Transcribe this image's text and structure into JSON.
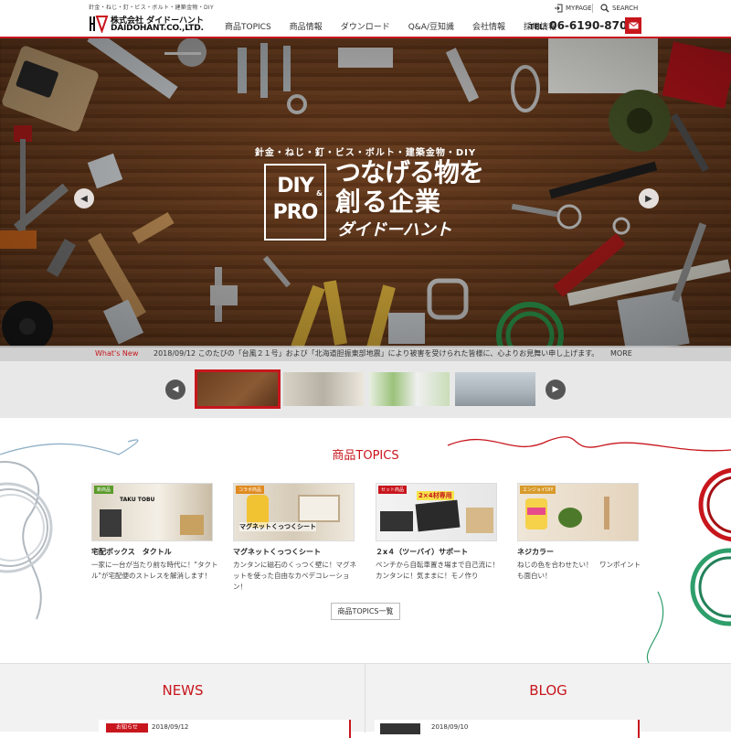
{
  "header": {
    "tagline": "針金・ねじ・釘・ビス・ボルト・建築金物・DIY",
    "logo_jp": "株式会社 ダイドーハント",
    "logo_en": "DAIDOHANT.CO.,LTD.",
    "mypage_label": "MYPAGE",
    "search_label": "SEARCH",
    "tel_label": "TEL:",
    "tel_number": "06-6190-8700",
    "nav": [
      {
        "label": "商品TOPICS"
      },
      {
        "label": "商品情報"
      },
      {
        "label": "ダウンロード"
      },
      {
        "label": "Q&A/豆知識"
      },
      {
        "label": "会社情報"
      },
      {
        "label": "採用情報"
      }
    ],
    "accent": "#c8161d"
  },
  "hero": {
    "subtitle": "針金・ねじ・釘・ビス・ボルト・建築金物・DIY",
    "badge_line1": "DIY",
    "badge_amp": "&",
    "badge_line2": "PRO",
    "catch_line1": "つなげる物を",
    "catch_line2": "創る企業",
    "catch_brand": "ダイドーハント"
  },
  "news_bar": {
    "label": "What's New",
    "text": "2018/09/12 このたびの「台風２１号」および「北海道胆振東部地震」により被害を受けられた皆様に、心よりお見舞い申し上げます。",
    "more": "MORE"
  },
  "topics": {
    "title": "商品TOPICS",
    "list_button": "商品TOPICS一覧",
    "items": [
      {
        "tag": "新商品",
        "image_text": "TAKU TOBU",
        "title": "宅配ボックス　タクトル",
        "desc": "一家に一台が当たり前な時代に！\"タクトル\"が宅配便のストレスを解消します！"
      },
      {
        "tag": "コラボ商品",
        "image_text": "マグネットくっつくシート",
        "title": "マグネットくっつくシート",
        "desc": "カンタンに磁石のくっつく壁に！マグネットを使った自由なカベデコレーション！"
      },
      {
        "tag": "セット商品",
        "image_text": "2×4材専用",
        "title": "２x４（ツーバイ）サポート",
        "desc": "ベンチから自転車置き場まで自己流に！カンタンに！気ままに！モノ作り"
      },
      {
        "tag": "エンジョイDIY",
        "image_text": "",
        "title": "ネジカラー",
        "desc": "ねじの色を合わせたい！　ワンポイントも面白い！"
      }
    ]
  },
  "news": {
    "title": "NEWS",
    "category": "お知らせ",
    "date": "2018/09/12"
  },
  "blog": {
    "title": "BLOG",
    "date": "2018/09/10"
  }
}
